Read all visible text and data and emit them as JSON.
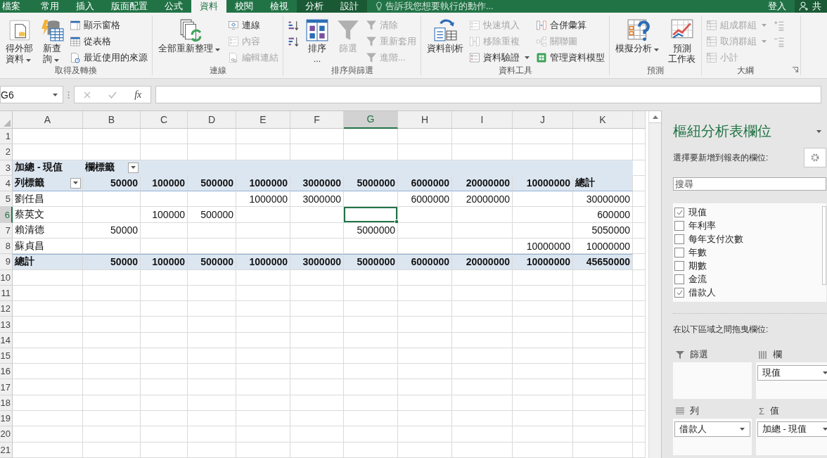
{
  "tabs": [
    {
      "label": "檔案",
      "selected": false,
      "kind": "normal"
    },
    {
      "label": "常用",
      "selected": false,
      "kind": "normal"
    },
    {
      "label": "插入",
      "selected": false,
      "kind": "normal"
    },
    {
      "label": "版面配置",
      "selected": false,
      "kind": "normal"
    },
    {
      "label": "公式",
      "selected": false,
      "kind": "normal"
    },
    {
      "label": "資料",
      "selected": true,
      "kind": "normal"
    },
    {
      "label": "校閱",
      "selected": false,
      "kind": "normal"
    },
    {
      "label": "檢視",
      "selected": false,
      "kind": "normal"
    },
    {
      "label": "分析",
      "selected": false,
      "kind": "context"
    },
    {
      "label": "設計",
      "selected": false,
      "kind": "context"
    }
  ],
  "tell_me": {
    "placeholder": "告訴我您想要執行的動作..."
  },
  "account": {
    "sign_in": "登入",
    "share": "共"
  },
  "ribbon_groups": [
    {
      "label": "取得及轉換",
      "columns": [
        {
          "kind": "large",
          "lines": [
            "得外部",
            "資料"
          ],
          "disabled": false,
          "dropdown": true
        },
        {
          "kind": "large",
          "lines": [
            "新查",
            "詢"
          ],
          "disabled": false,
          "dropdown": true
        },
        {
          "kind": "stack",
          "items": [
            {
              "kind": "labeled",
              "label": "顯示窗格",
              "disabled": false,
              "dropdown": false
            },
            {
              "kind": "labeled",
              "label": "從表格",
              "disabled": false,
              "dropdown": false
            },
            {
              "kind": "labeled",
              "label": "最近使用的來源",
              "disabled": false,
              "dropdown": false
            }
          ]
        }
      ]
    },
    {
      "label": "連線",
      "columns": [
        {
          "kind": "large",
          "lines": [
            "全部重新整理"
          ],
          "disabled": false,
          "dropdown": true
        },
        {
          "kind": "stack",
          "items": [
            {
              "kind": "labeled",
              "label": "連線",
              "disabled": false,
              "dropdown": false
            },
            {
              "kind": "labeled",
              "label": "內容",
              "disabled": true,
              "dropdown": false
            },
            {
              "kind": "labeled",
              "label": "編輯連結",
              "disabled": true,
              "dropdown": false
            }
          ]
        }
      ]
    },
    {
      "label": "排序與篩選",
      "columns": [
        {
          "kind": "stack",
          "items": [
            {
              "kind": "icon",
              "disabled": false,
              "dropdown": false
            },
            {
              "kind": "icon",
              "disabled": false,
              "dropdown": false
            }
          ]
        },
        {
          "kind": "large",
          "lines": [
            "排序",
            "..."
          ],
          "disabled": false,
          "dropdown": false
        },
        {
          "kind": "large",
          "lines": [
            "篩選"
          ],
          "disabled": true,
          "dropdown": false
        },
        {
          "kind": "stack",
          "items": [
            {
              "kind": "labeled",
              "label": "清除",
              "disabled": true,
              "dropdown": false
            },
            {
              "kind": "labeled",
              "label": "重新套用",
              "disabled": true,
              "dropdown": false
            },
            {
              "kind": "labeled",
              "label": "進階...",
              "disabled": true,
              "dropdown": false
            }
          ]
        }
      ]
    },
    {
      "label": "資料工具",
      "columns": [
        {
          "kind": "large",
          "lines": [
            "資料剖析"
          ],
          "disabled": false,
          "dropdown": false
        },
        {
          "kind": "stack",
          "items": [
            {
              "kind": "labeled",
              "label": "快速填入",
              "disabled": true,
              "dropdown": false
            },
            {
              "kind": "labeled",
              "label": "移除重複",
              "disabled": true,
              "dropdown": false
            },
            {
              "kind": "labeled",
              "label": "資料驗證",
              "disabled": false,
              "dropdown": true
            }
          ]
        },
        {
          "kind": "stack",
          "items": [
            {
              "kind": "labeled",
              "label": "合併彙算",
              "disabled": false,
              "dropdown": false
            },
            {
              "kind": "labeled",
              "label": "關聯圖",
              "disabled": true,
              "dropdown": false
            },
            {
              "kind": "labeled",
              "label": "管理資料模型",
              "disabled": false,
              "dropdown": false
            }
          ]
        }
      ]
    },
    {
      "label": "預測",
      "columns": [
        {
          "kind": "large",
          "lines": [
            "模擬分析"
          ],
          "disabled": false,
          "dropdown": true
        },
        {
          "kind": "large",
          "lines": [
            "預測",
            "工作表"
          ],
          "disabled": false,
          "dropdown": false
        }
      ]
    },
    {
      "label": "大綱",
      "launcher": true,
      "columns": [
        {
          "kind": "stack",
          "items": [
            {
              "kind": "labeled",
              "label": "組成群組",
              "disabled": true,
              "dropdown": true
            },
            {
              "kind": "labeled",
              "label": "取消群組",
              "disabled": true,
              "dropdown": true
            },
            {
              "kind": "labeled",
              "label": "小計",
              "disabled": true,
              "dropdown": false
            }
          ]
        },
        {
          "kind": "stack",
          "items": [
            {
              "kind": "icon",
              "disabled": true,
              "dropdown": false
            },
            {
              "kind": "icon",
              "disabled": true,
              "dropdown": false
            }
          ]
        }
      ]
    }
  ],
  "formula_bar": {
    "name_box": "G6",
    "function_label": "fx"
  },
  "sheet": {
    "columns": [
      {
        "label": "A",
        "selected": false
      },
      {
        "label": "B",
        "selected": false
      },
      {
        "label": "C",
        "selected": false
      },
      {
        "label": "D",
        "selected": false
      },
      {
        "label": "E",
        "selected": false
      },
      {
        "label": "F",
        "selected": false
      },
      {
        "label": "G",
        "selected": true
      },
      {
        "label": "H",
        "selected": false
      },
      {
        "label": "I",
        "selected": false
      },
      {
        "label": "J",
        "selected": false
      },
      {
        "label": "K",
        "selected": false
      }
    ],
    "rows": [
      {
        "label": "1",
        "selected": false,
        "kind": "plain"
      },
      {
        "label": "2",
        "selected": false,
        "kind": "plain"
      },
      {
        "label": "3",
        "selected": false,
        "kind": "pivot-head",
        "cells": [
          {
            "kind": "label",
            "text": "加總 - 現值"
          },
          {
            "kind": "label",
            "text": "欄標籤",
            "filter": true
          },
          {
            "kind": "blank"
          },
          {
            "kind": "blank"
          },
          {
            "kind": "blank"
          },
          {
            "kind": "blank"
          },
          {
            "kind": "blank"
          },
          {
            "kind": "blank"
          },
          {
            "kind": "blank"
          },
          {
            "kind": "blank"
          },
          {
            "kind": "blank"
          }
        ]
      },
      {
        "label": "4",
        "selected": false,
        "kind": "pivot-head",
        "cells": [
          {
            "kind": "label",
            "text": "列標籤",
            "filter": true
          },
          {
            "kind": "number",
            "text": "50000"
          },
          {
            "kind": "number",
            "text": "100000"
          },
          {
            "kind": "number",
            "text": "500000"
          },
          {
            "kind": "number",
            "text": "1000000"
          },
          {
            "kind": "number",
            "text": "3000000"
          },
          {
            "kind": "number",
            "text": "5000000"
          },
          {
            "kind": "number",
            "text": "6000000"
          },
          {
            "kind": "number",
            "text": "20000000"
          },
          {
            "kind": "number",
            "text": "10000000"
          },
          {
            "kind": "label",
            "text": "總計"
          }
        ]
      },
      {
        "label": "5",
        "selected": false,
        "kind": "pivot-item",
        "cells": [
          {
            "kind": "label",
            "text": "劉任昌"
          },
          {
            "kind": "blank"
          },
          {
            "kind": "blank"
          },
          {
            "kind": "blank"
          },
          {
            "kind": "number",
            "text": "1000000"
          },
          {
            "kind": "number",
            "text": "3000000"
          },
          {
            "kind": "blank"
          },
          {
            "kind": "number",
            "text": "6000000"
          },
          {
            "kind": "number",
            "text": "20000000"
          },
          {
            "kind": "blank"
          },
          {
            "kind": "number",
            "text": "30000000"
          }
        ]
      },
      {
        "label": "6",
        "selected": true,
        "kind": "pivot-item",
        "cells": [
          {
            "kind": "label",
            "text": "蔡英文"
          },
          {
            "kind": "blank"
          },
          {
            "kind": "number",
            "text": "100000"
          },
          {
            "kind": "number",
            "text": "500000"
          },
          {
            "kind": "blank"
          },
          {
            "kind": "blank"
          },
          {
            "kind": "blank"
          },
          {
            "kind": "blank"
          },
          {
            "kind": "blank"
          },
          {
            "kind": "blank"
          },
          {
            "kind": "number",
            "text": "600000"
          }
        ]
      },
      {
        "label": "7",
        "selected": false,
        "kind": "pivot-item",
        "cells": [
          {
            "kind": "label",
            "text": "賴清德"
          },
          {
            "kind": "number",
            "text": "50000"
          },
          {
            "kind": "blank"
          },
          {
            "kind": "blank"
          },
          {
            "kind": "blank"
          },
          {
            "kind": "blank"
          },
          {
            "kind": "number",
            "text": "5000000"
          },
          {
            "kind": "blank"
          },
          {
            "kind": "blank"
          },
          {
            "kind": "blank"
          },
          {
            "kind": "number",
            "text": "5050000"
          }
        ]
      },
      {
        "label": "8",
        "selected": false,
        "kind": "pivot-item",
        "cells": [
          {
            "kind": "label",
            "text": "蘇貞昌"
          },
          {
            "kind": "blank"
          },
          {
            "kind": "blank"
          },
          {
            "kind": "blank"
          },
          {
            "kind": "blank"
          },
          {
            "kind": "blank"
          },
          {
            "kind": "blank"
          },
          {
            "kind": "blank"
          },
          {
            "kind": "blank"
          },
          {
            "kind": "number",
            "text": "10000000"
          },
          {
            "kind": "number",
            "text": "10000000"
          }
        ]
      },
      {
        "label": "9",
        "selected": false,
        "kind": "pivot-total",
        "cells": [
          {
            "kind": "label",
            "text": "總計"
          },
          {
            "kind": "number",
            "text": "50000"
          },
          {
            "kind": "number",
            "text": "100000"
          },
          {
            "kind": "number",
            "text": "500000"
          },
          {
            "kind": "number",
            "text": "1000000"
          },
          {
            "kind": "number",
            "text": "3000000"
          },
          {
            "kind": "number",
            "text": "5000000"
          },
          {
            "kind": "number",
            "text": "6000000"
          },
          {
            "kind": "number",
            "text": "20000000"
          },
          {
            "kind": "number",
            "text": "10000000"
          },
          {
            "kind": "number",
            "text": "45650000"
          }
        ]
      },
      {
        "label": "10",
        "selected": false,
        "kind": "plain"
      },
      {
        "label": "11",
        "selected": false,
        "kind": "plain"
      },
      {
        "label": "12",
        "selected": false,
        "kind": "plain"
      },
      {
        "label": "13",
        "selected": false,
        "kind": "plain"
      },
      {
        "label": "14",
        "selected": false,
        "kind": "plain"
      },
      {
        "label": "15",
        "selected": false,
        "kind": "plain"
      },
      {
        "label": "16",
        "selected": false,
        "kind": "plain"
      },
      {
        "label": "17",
        "selected": false,
        "kind": "plain"
      },
      {
        "label": "18",
        "selected": false,
        "kind": "plain"
      },
      {
        "label": "19",
        "selected": false,
        "kind": "plain"
      },
      {
        "label": "20",
        "selected": false,
        "kind": "plain"
      },
      {
        "label": "21",
        "selected": false,
        "kind": "plain"
      }
    ]
  },
  "pivot_panel": {
    "title": "樞紐分析表欄位",
    "subtitle": "選擇要新增到報表的欄位:",
    "search": {
      "placeholder": "搜尋"
    },
    "fields": [
      {
        "label": "現值",
        "checked": true
      },
      {
        "label": "年利率",
        "checked": false
      },
      {
        "label": "每年支付次數",
        "checked": false
      },
      {
        "label": "年數",
        "checked": false
      },
      {
        "label": "期數",
        "checked": false
      },
      {
        "label": "金流",
        "checked": false
      },
      {
        "label": "借款人",
        "checked": true
      }
    ],
    "areas_hint": "在以下區域之間拖曳欄位:",
    "areas": [
      {
        "kind": "filter",
        "label": "篩選"
      },
      {
        "kind": "columns",
        "label": "欄",
        "items": [
          "現值"
        ]
      },
      {
        "kind": "rows",
        "label": "列",
        "items": [
          "借款人"
        ]
      },
      {
        "kind": "values",
        "label": "值",
        "symbol": "Σ",
        "items": [
          "加總 - 現值"
        ]
      }
    ]
  }
}
